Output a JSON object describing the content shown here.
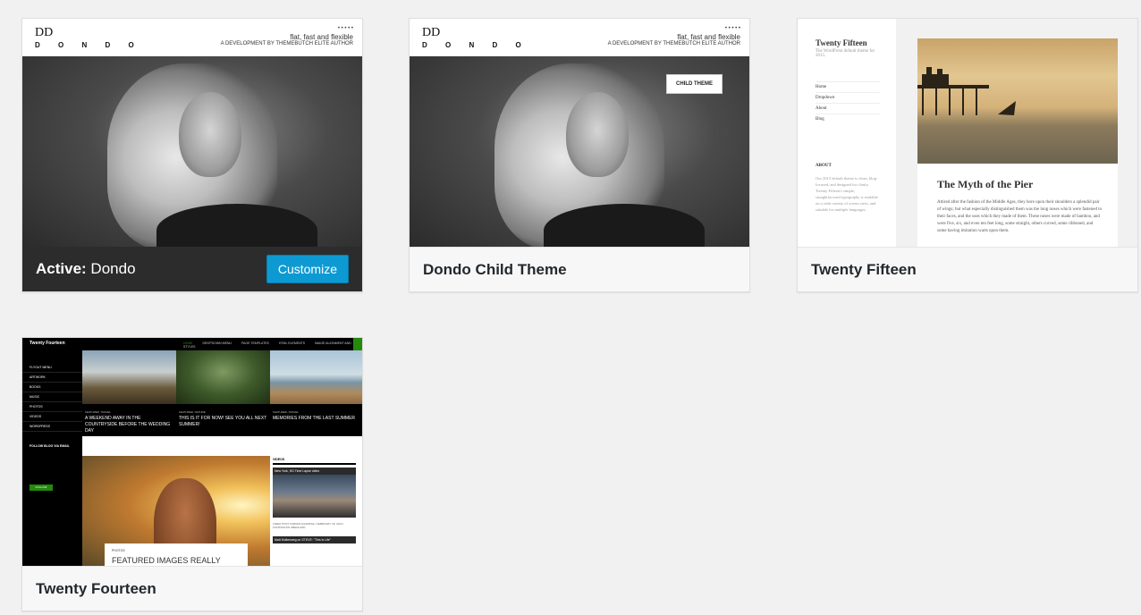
{
  "themes": [
    {
      "name": "Dondo",
      "active_prefix": "Active:",
      "customize_label": "Customize",
      "preview": {
        "logo": "DD",
        "wordmark": "D O N D O",
        "tagline_small": "• • • • •",
        "tagline": "flat, fast and flexible",
        "tagline_sub": "A DEVELOPMENT BY THEMEBUTCH ELITE AUTHOR"
      }
    },
    {
      "name": "Dondo Child Theme",
      "preview": {
        "logo": "DD",
        "wordmark": "D O N D O",
        "tagline_small": "• • • • •",
        "tagline": "flat, fast and flexible",
        "tagline_sub": "A DEVELOPMENT BY THEMEBUTCH ELITE AUTHOR",
        "badge": "CHILD THEME"
      }
    },
    {
      "name": "Twenty Fifteen",
      "preview": {
        "site_title": "Twenty Fifteen",
        "site_desc": "The WordPress default theme for 2015.",
        "menu": [
          "Home",
          "Dropdown",
          "About",
          "Blog"
        ],
        "about_heading": "ABOUT",
        "about_text": "Our 2015 default theme is clean, blog-focused, and designed for clarity. Twenty Fifteen's simple, straightforward typography is readable on a wide variety of screen sizes, and suitable for multiple languages.",
        "post_title": "The Myth of the Pier",
        "post_text": "Attired after the fashion of the Middle Ages, they bore upon their shoulders a splendid pair of wings; but what especially distinguished them was the long noses which were fastened to their faces, and the uses which they made of them. These noses were made of bamboo, and were five, six, and even ten feet long, some straight, others curved, some ribboned, and some having imitation warts upon them."
      }
    },
    {
      "name": "Twenty Fourteen",
      "preview": {
        "brand": "Twenty Fourteen",
        "nav": [
          "HOME",
          "DROPDOWN MENU",
          "PAGE TEMPLATES",
          "HTML ELEMENTS",
          "IMAGE ALIGNMENT AND STYLES"
        ],
        "sidebar": [
          "FLYOUT MENU",
          "ARTWORK",
          "BOOKS",
          "MUSIC",
          "PHOTOS",
          "VIDEOS",
          "WORDPRESS"
        ],
        "follow_heading": "FOLLOW BLOG VIA EMAIL",
        "follow_button": "FOLLOW",
        "features": [
          {
            "label": "FEATURED, TRAVEL",
            "title": "A WEEKEND AWAY IN THE COUNTRYSIDE BEFORE THE WEDDING DAY"
          },
          {
            "label": "FEATURED, NATURE",
            "title": "THIS IS IT FOR NOW! SEE YOU ALL NEXT SUMMER!"
          },
          {
            "label": "FEATURED, TRAVEL",
            "title": "MEMORIES FROM THE LAST SUMMER"
          }
        ],
        "featured_label": "PHOTOS",
        "featured_text": "FEATURED IMAGES REALLY",
        "videos_heading": "VIDEOS",
        "video1": "New York, HD Time Lapse video",
        "video_caption": "VIDEO POST FORMAT EXAMPLE / FEBRUARY 18, 2013 / KONSTANTIN OBENLAND",
        "video2": "Matt Mullenweg on STEVE: \"This is Life\""
      }
    }
  ],
  "colors": {
    "accent": "#0d9ad3",
    "active_bar": "#2c2c2c",
    "page_bg": "#f1f1f1"
  }
}
